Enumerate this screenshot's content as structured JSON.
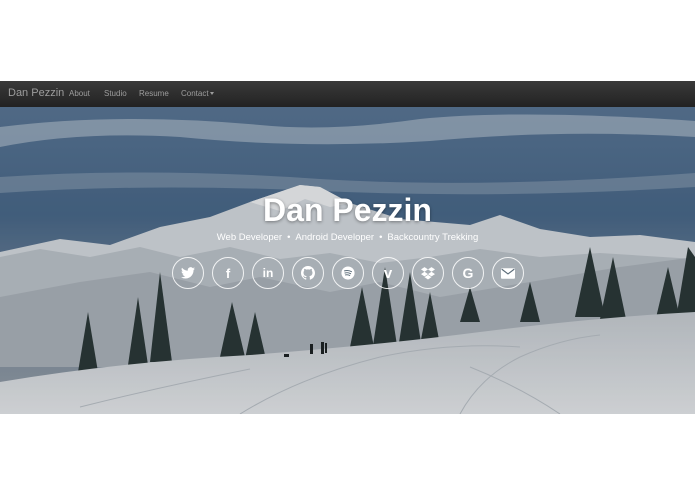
{
  "navbar": {
    "brand": "Dan Pezzin",
    "items": [
      {
        "label": "About"
      },
      {
        "label": "Studio"
      },
      {
        "label": "Resume"
      },
      {
        "label": "Contact"
      }
    ]
  },
  "hero": {
    "title": "Dan Pezzin",
    "roles": [
      "Web Developer",
      "Android Developer",
      "Backcountry Trekking"
    ],
    "separator": "•",
    "social": [
      {
        "icon": "twitter-icon",
        "glyph": ""
      },
      {
        "icon": "facebook-icon",
        "glyph": "f"
      },
      {
        "icon": "linkedin-icon",
        "glyph": "in"
      },
      {
        "icon": "github-icon",
        "glyph": ""
      },
      {
        "icon": "spotify-icon",
        "glyph": ""
      },
      {
        "icon": "vimeo-icon",
        "glyph": "v"
      },
      {
        "icon": "dropbox-icon",
        "glyph": ""
      },
      {
        "icon": "google-icon",
        "glyph": "G"
      },
      {
        "icon": "envelope-icon",
        "glyph": ""
      }
    ]
  },
  "colors": {
    "navbar": "#222222",
    "nav_text": "#9d9d9d",
    "hero_text": "#ffffff"
  }
}
